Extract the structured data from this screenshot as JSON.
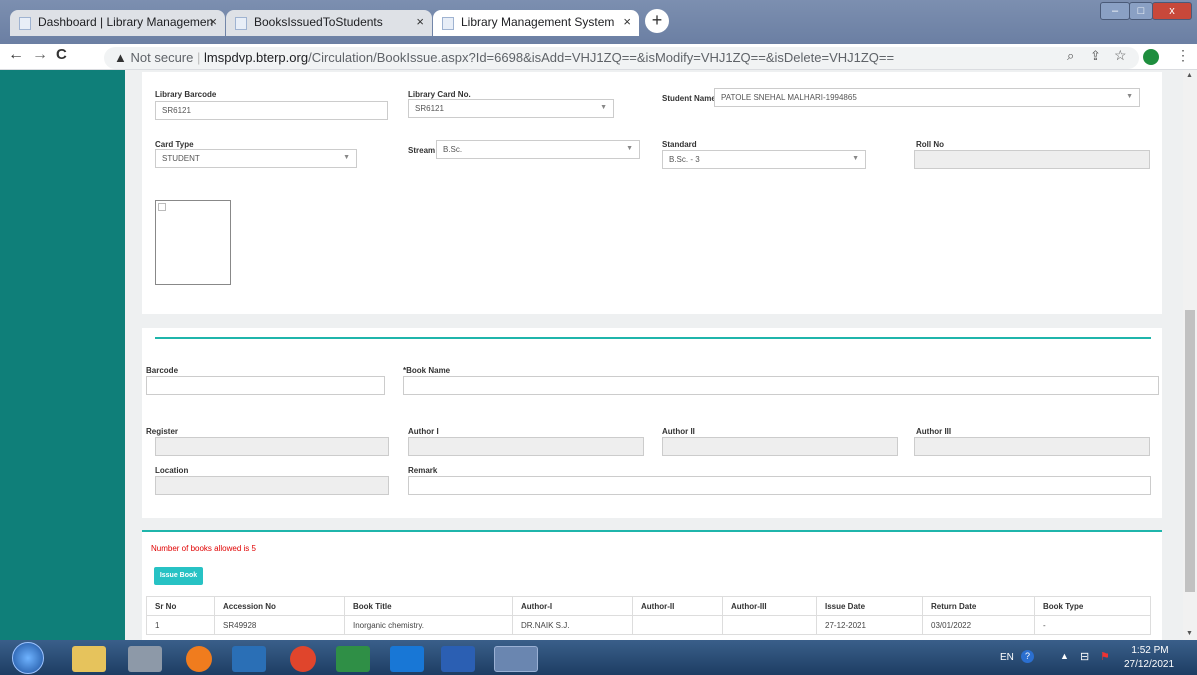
{
  "browser": {
    "tabs": [
      {
        "title": "Dashboard | Library Managemen",
        "close": "×"
      },
      {
        "title": "BooksIssuedToStudents",
        "close": "×"
      },
      {
        "title": "Library Management System",
        "close": "×"
      }
    ],
    "new_tab": "+",
    "nav": {
      "back": "←",
      "forward": "→",
      "reload": "C"
    },
    "security": "Not secure",
    "url_host": "lmspdvp.bterp.org",
    "url_path": "/Circulation/BookIssue.aspx?Id=6698&isAdd=VHJ1ZQ==&isModify=VHJ1ZQ==&isDelete=VHJ1ZQ==",
    "window_buttons": {
      "minimize": "–",
      "maximize": "□",
      "close": "x"
    }
  },
  "student": {
    "library_barcode_label": "Library Barcode",
    "library_barcode_value": "SR6121",
    "library_card_label": "Library Card No.",
    "library_card_value": "SR6121",
    "student_name_label": "Student Name",
    "student_name_value": "PATOLE SNEHAL MALHARI-1994865",
    "card_type_label": "Card Type",
    "card_type_value": "STUDENT",
    "stream_label": "Stream",
    "stream_value": "B.Sc.",
    "standard_label": "Standard",
    "standard_value": "B.Sc. - 3",
    "roll_no_label": "Roll No",
    "roll_no_value": ""
  },
  "book": {
    "barcode_label": "Barcode",
    "book_name_label": "*Book Name",
    "register_label": "Register",
    "author1_label": "Author I",
    "author2_label": "Author II",
    "author3_label": "Author III",
    "location_label": "Location",
    "remark_label": "Remark"
  },
  "issue": {
    "limit_text": "Number of books allowed is 5",
    "issue_button": "Issue Book",
    "columns": [
      "Sr No",
      "Accession No",
      "Book Title",
      "Author-I",
      "Author-II",
      "Author-III",
      "Issue Date",
      "Return Date",
      "Book Type"
    ],
    "rows": [
      [
        "1",
        "SR49928",
        "Inorganic chemistry.",
        "DR.NAIK S.J.",
        "",
        "",
        "27-12-2021",
        "03/01/2022",
        "-"
      ]
    ]
  },
  "taskbar": {
    "lang": "EN",
    "time": "1:52 PM",
    "date": "27/12/2021"
  },
  "colors": {
    "sidebar": "#0f7f79",
    "accent": "#1fb5ab",
    "warning_text": "#e00000"
  }
}
